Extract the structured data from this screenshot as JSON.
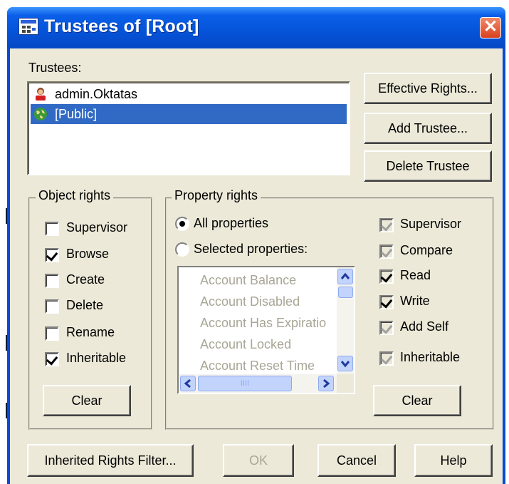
{
  "window": {
    "title": "Trustees of [Root]",
    "close_glyph": "✕"
  },
  "trustees": {
    "label": "Trustees:",
    "items": [
      {
        "name": "admin.Oktatas",
        "icon": "user-icon",
        "selected": false
      },
      {
        "name": "[Public]",
        "icon": "globe-icon",
        "selected": true
      }
    ]
  },
  "side_buttons": {
    "effective_rights": "Effective Rights...",
    "add_trustee": "Add Trustee...",
    "delete_trustee": "Delete Trustee"
  },
  "object_rights": {
    "title": "Object rights",
    "items": [
      {
        "label": "Supervisor",
        "checked": false
      },
      {
        "label": "Browse",
        "checked": true
      },
      {
        "label": "Create",
        "checked": false
      },
      {
        "label": "Delete",
        "checked": false
      },
      {
        "label": "Rename",
        "checked": false
      },
      {
        "label": "Inheritable",
        "checked": true
      }
    ],
    "clear_label": "Clear"
  },
  "property_rights": {
    "title": "Property rights",
    "all_properties": "All properties",
    "selected_properties": "Selected properties:",
    "selected_option": "All properties",
    "properties": [
      "Account Balance",
      "Account Disabled",
      "Account Has Expiratio",
      "Account Locked",
      "Account Reset Time"
    ],
    "rights": [
      {
        "label": "Supervisor",
        "checked": false
      },
      {
        "label": "Compare",
        "checked": false
      },
      {
        "label": "Read",
        "checked": true
      },
      {
        "label": "Write",
        "checked": true
      },
      {
        "label": "Add Self",
        "checked": false
      },
      {
        "label": "Inheritable",
        "checked": false
      }
    ],
    "clear_label": "Clear",
    "hscroll_grip": "IIII"
  },
  "footer": {
    "inherited_rights_filter": "Inherited Rights Filter...",
    "ok": "OK",
    "cancel": "Cancel",
    "help": "Help"
  },
  "colors": {
    "title_bar": "#0553d8",
    "dialog_face": "#ece9d8",
    "selection": "#316ac5",
    "close_button": "#d9411f"
  }
}
